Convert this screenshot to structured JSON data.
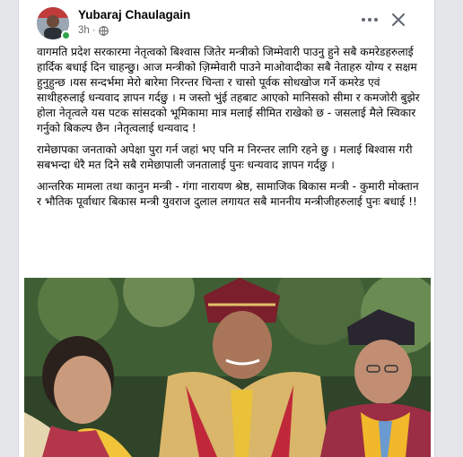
{
  "post": {
    "author": "Yubaraj Chaulagain",
    "time": "3h",
    "separator": "·",
    "paragraphs": [
      "वागमति प्रदेश सरकारमा नेतृत्वको बिश्वास जितेर मन्त्रीको जिम्मेवारी पाउनु हुने सबै कमरेडहरुलाई हार्दिक बधाई दिन चाहन्छु। आज मन्त्रीको ज़िम्मेवारी पाउने माओवादीका सबै नेताहरु योग्य र सक्षम हुनुहुन्छ ।यस सन्दर्भमा मेरो बारेमा निरन्तर चिन्ता र चासो पूर्वक सोधखोज गर्ने कमरेड एवं साथीहरुलाई धन्यवाद ज्ञापन गर्दछु । म जस्तो भुंई तहबाट आएको मानिसको सीमा र कमजोरी बुझेर होला नेतृत्वले यस पटक सांसदको भूमिकामा मात्र मलाई सीमित राखेको छ - जसलाई मैले स्विकार गर्नुको बिकल्प छैन ।नेतृत्वलाई धन्यवाद !",
      "रामेछापका जनताको अपेक्षा पुरा गर्न जहां भए पनि म निरन्तर लागि रहने छु । मलाई बिश्वास गरी सबभन्दा धेरै मत दिने सबै रामेछापाली जनतालाई पुनः धन्यवाद ज्ञापन गर्दछु ।",
      "आन्तरिक मामला तथा कानुन मन्त्री - गंगा नारायण श्रेष्ठ, सामाजिक बिकास मन्त्री - कुमारी मोक्तान र भौतिक पूर्वाधार बिकास मन्त्री युवराज दुलाल लगायत सबै माननीय मन्त्रीजीहरुलाई पुनः बधाई !!"
    ]
  },
  "icons": {
    "more": "more-options-icon",
    "close": "close-icon",
    "privacy": "globe-icon"
  },
  "colors": {
    "author_text": "#050505",
    "meta_text": "#65676b",
    "online": "#31a24c",
    "page_bg": "#e4e6ea"
  }
}
